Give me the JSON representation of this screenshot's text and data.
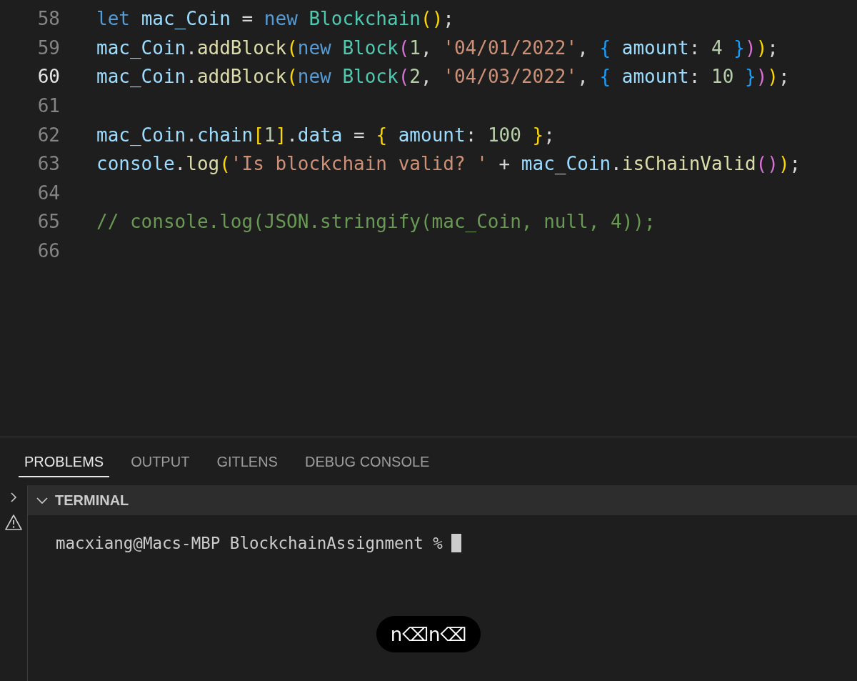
{
  "editor": {
    "lines": [
      {
        "number": "58",
        "current": false,
        "tokens": [
          {
            "kind": "keyword",
            "text": "let "
          },
          {
            "kind": "variable",
            "text": "mac_Coin"
          },
          {
            "kind": "plain",
            "text": " = "
          },
          {
            "kind": "keyword",
            "text": "new "
          },
          {
            "kind": "class",
            "text": "Blockchain"
          },
          {
            "kind": "bracket1",
            "text": "()"
          },
          {
            "kind": "plain",
            "text": ";"
          }
        ]
      },
      {
        "number": "59",
        "current": false,
        "tokens": [
          {
            "kind": "variable",
            "text": "mac_Coin"
          },
          {
            "kind": "plain",
            "text": "."
          },
          {
            "kind": "function",
            "text": "addBlock"
          },
          {
            "kind": "bracket1",
            "text": "("
          },
          {
            "kind": "keyword",
            "text": "new "
          },
          {
            "kind": "class",
            "text": "Block"
          },
          {
            "kind": "bracket2",
            "text": "("
          },
          {
            "kind": "number",
            "text": "1"
          },
          {
            "kind": "plain",
            "text": ", "
          },
          {
            "kind": "string",
            "text": "'04/01/2022'"
          },
          {
            "kind": "plain",
            "text": ", "
          },
          {
            "kind": "bracket3",
            "text": "{ "
          },
          {
            "kind": "variable",
            "text": "amount"
          },
          {
            "kind": "plain",
            "text": ": "
          },
          {
            "kind": "number",
            "text": "4 "
          },
          {
            "kind": "bracket3",
            "text": "}"
          },
          {
            "kind": "bracket2",
            "text": ")"
          },
          {
            "kind": "bracket1",
            "text": ")"
          },
          {
            "kind": "plain",
            "text": ";"
          }
        ]
      },
      {
        "number": "60",
        "current": true,
        "tokens": [
          {
            "kind": "variable",
            "text": "mac_Coin"
          },
          {
            "kind": "plain",
            "text": "."
          },
          {
            "kind": "function",
            "text": "addBlock"
          },
          {
            "kind": "bracket1",
            "text": "("
          },
          {
            "kind": "keyword",
            "text": "new "
          },
          {
            "kind": "class",
            "text": "Block"
          },
          {
            "kind": "bracket2",
            "text": "("
          },
          {
            "kind": "number",
            "text": "2"
          },
          {
            "kind": "plain",
            "text": ", "
          },
          {
            "kind": "string",
            "text": "'04/03/2022'"
          },
          {
            "kind": "plain",
            "text": ", "
          },
          {
            "kind": "bracket3",
            "text": "{ "
          },
          {
            "kind": "variable",
            "text": "amount"
          },
          {
            "kind": "plain",
            "text": ": "
          },
          {
            "kind": "number",
            "text": "10 "
          },
          {
            "kind": "bracket3",
            "text": "}"
          },
          {
            "kind": "bracket2",
            "text": ")"
          },
          {
            "kind": "bracket1",
            "text": ")"
          },
          {
            "kind": "plain",
            "text": ";"
          }
        ]
      },
      {
        "number": "61",
        "current": false
      },
      {
        "number": "62",
        "current": false,
        "tokens": [
          {
            "kind": "variable",
            "text": "mac_Coin"
          },
          {
            "kind": "plain",
            "text": "."
          },
          {
            "kind": "variable",
            "text": "chain"
          },
          {
            "kind": "bracket1",
            "text": "["
          },
          {
            "kind": "number",
            "text": "1"
          },
          {
            "kind": "bracket1",
            "text": "]"
          },
          {
            "kind": "plain",
            "text": "."
          },
          {
            "kind": "variable",
            "text": "data"
          },
          {
            "kind": "plain",
            "text": " = "
          },
          {
            "kind": "bracket1",
            "text": "{ "
          },
          {
            "kind": "variable",
            "text": "amount"
          },
          {
            "kind": "plain",
            "text": ": "
          },
          {
            "kind": "number",
            "text": "100 "
          },
          {
            "kind": "bracket1",
            "text": "}"
          },
          {
            "kind": "plain",
            "text": ";"
          }
        ]
      },
      {
        "number": "63",
        "current": false,
        "tokens": [
          {
            "kind": "variable",
            "text": "console"
          },
          {
            "kind": "plain",
            "text": "."
          },
          {
            "kind": "function",
            "text": "log"
          },
          {
            "kind": "bracket1",
            "text": "("
          },
          {
            "kind": "string",
            "text": "'Is blockchain valid? '"
          },
          {
            "kind": "plain",
            "text": " + "
          },
          {
            "kind": "variable",
            "text": "mac_Coin"
          },
          {
            "kind": "plain",
            "text": "."
          },
          {
            "kind": "function",
            "text": "isChainValid"
          },
          {
            "kind": "bracket2",
            "text": "()"
          },
          {
            "kind": "bracket1",
            "text": ")"
          },
          {
            "kind": "plain",
            "text": ";"
          }
        ]
      },
      {
        "number": "64",
        "current": false
      },
      {
        "number": "65",
        "current": false,
        "tokens": [
          {
            "kind": "comment",
            "text": "// console.log(JSON.stringify(mac_Coin, null, 4));"
          }
        ]
      },
      {
        "number": "66",
        "current": false
      }
    ]
  },
  "panel_tabs": [
    {
      "label": "PROBLEMS",
      "selected": true
    },
    {
      "label": "OUTPUT",
      "selected": false
    },
    {
      "label": "GITLENS",
      "selected": false
    },
    {
      "label": "DEBUG CONSOLE",
      "selected": false
    }
  ],
  "terminal": {
    "title": "TERMINAL",
    "expanded": true,
    "prompt": "macxiang@Macs-MBP BlockchainAssignment %"
  },
  "keystrokes": "n⌫n⌫"
}
